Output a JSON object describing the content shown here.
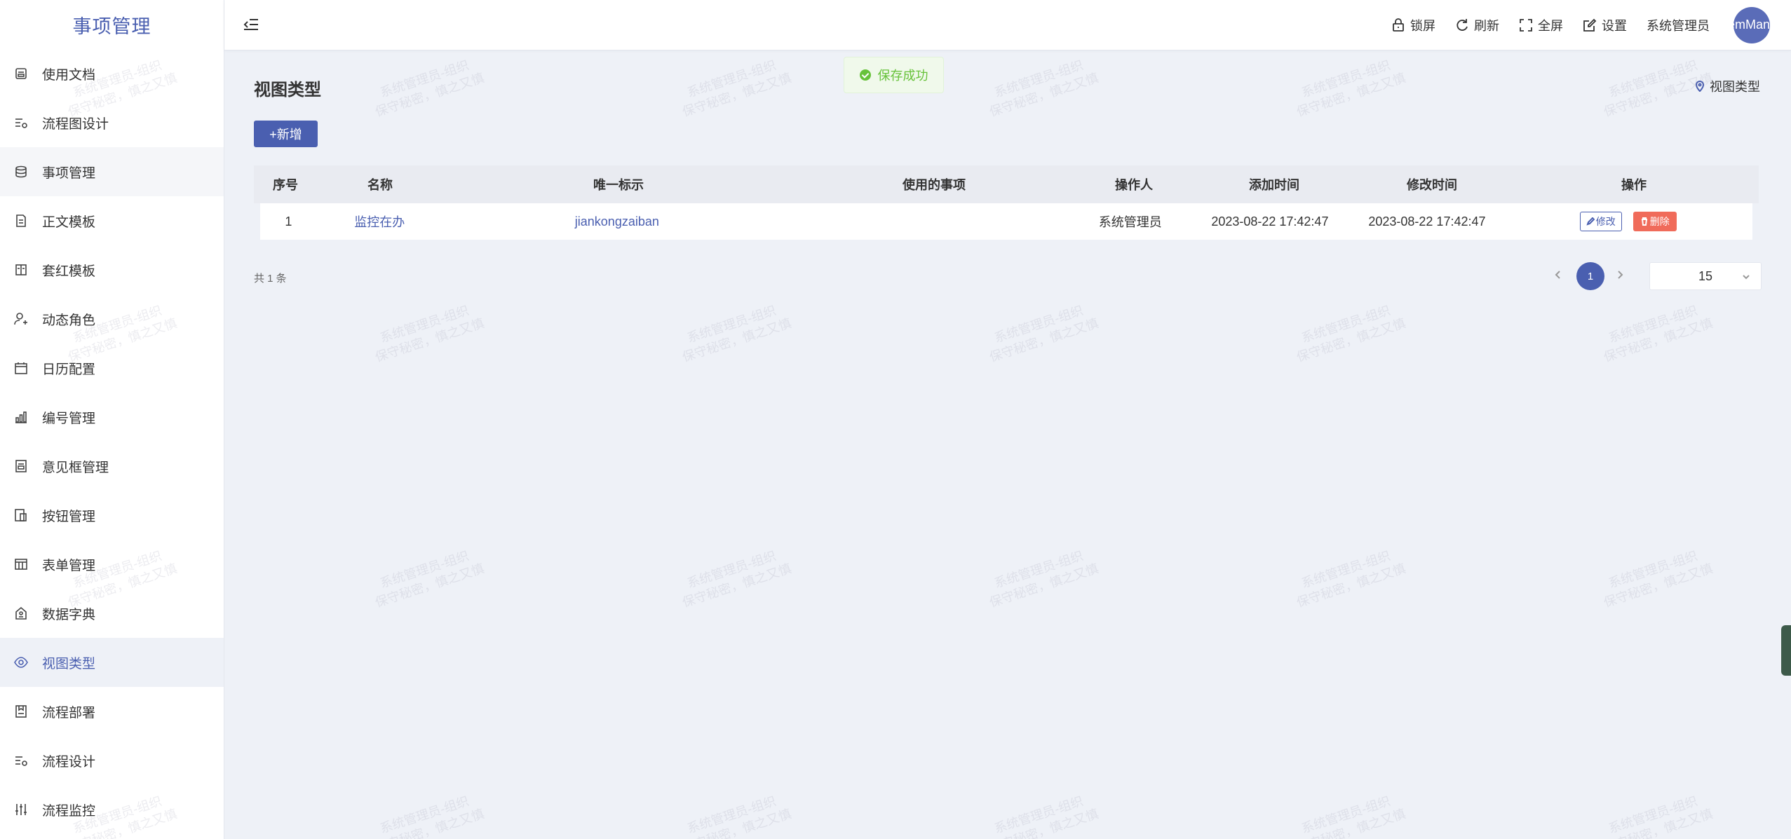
{
  "app": {
    "title": "事项管理"
  },
  "header": {
    "lock": "锁屏",
    "refresh": "刷新",
    "fullscreen": "全屏",
    "settings": "设置",
    "username": "系统管理员",
    "avatar_text": "emMan"
  },
  "sidebar": {
    "items": [
      {
        "label": "使用文档",
        "icon": "document-icon"
      },
      {
        "label": "流程图设计",
        "icon": "flow-design-icon"
      },
      {
        "label": "事项管理",
        "icon": "database-icon"
      },
      {
        "label": "正文模板",
        "icon": "text-template-icon"
      },
      {
        "label": "套红模板",
        "icon": "red-template-icon"
      },
      {
        "label": "动态角色",
        "icon": "user-role-icon"
      },
      {
        "label": "日历配置",
        "icon": "calendar-icon"
      },
      {
        "label": "编号管理",
        "icon": "bar-chart-icon"
      },
      {
        "label": "意见框管理",
        "icon": "opinion-box-icon"
      },
      {
        "label": "按钮管理",
        "icon": "button-icon"
      },
      {
        "label": "表单管理",
        "icon": "table-icon"
      },
      {
        "label": "数据字典",
        "icon": "dictionary-icon"
      },
      {
        "label": "视图类型",
        "icon": "eye-icon"
      },
      {
        "label": "流程部署",
        "icon": "deploy-icon"
      },
      {
        "label": "流程设计",
        "icon": "flow-design-icon"
      },
      {
        "label": "流程监控",
        "icon": "monitor-icon"
      }
    ]
  },
  "toast": {
    "text": "保存成功"
  },
  "page": {
    "title": "视图类型",
    "breadcrumb": "视图类型",
    "add_button": "+新增"
  },
  "table": {
    "headers": [
      "序号",
      "名称",
      "唯一标示",
      "使用的事项",
      "操作人",
      "添加时间",
      "修改时间",
      "操作"
    ],
    "rows": [
      {
        "index": "1",
        "name": "监控在办",
        "key": "jiankongzaiban",
        "used_items": "",
        "operator": "系统管理员",
        "created": "2023-08-22 17:42:47",
        "modified": "2023-08-22 17:42:47",
        "edit_label": "修改",
        "delete_label": "删除"
      }
    ]
  },
  "pagination": {
    "total": "共 1 条",
    "current_page": "1",
    "page_size": "15"
  },
  "watermark": {
    "line1": "系统管理员-组织",
    "line2": "保守秘密，慎之又慎"
  },
  "colors": {
    "accent": "#4a5fb0",
    "danger": "#f06b5a",
    "success": "#67c23a"
  }
}
